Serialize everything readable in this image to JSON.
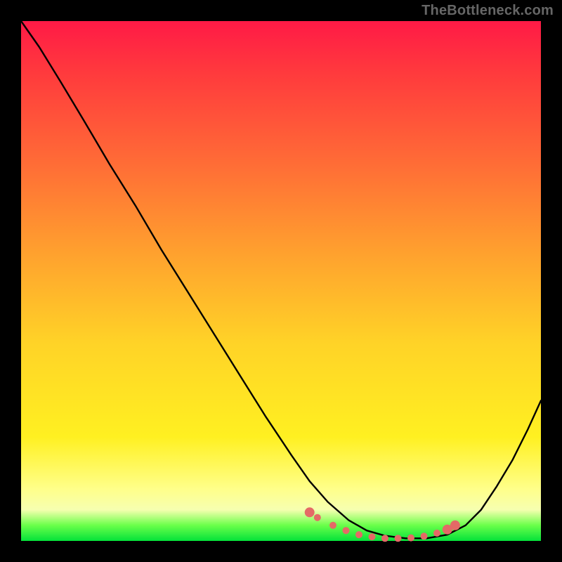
{
  "watermark": "TheBottleneck.com",
  "colors": {
    "frame": "#000000",
    "watermark_text": "#666666",
    "gradient_stops": [
      "#ff1a46",
      "#ff3a3d",
      "#ff6e36",
      "#ffa22e",
      "#ffd327",
      "#fff021",
      "#ffff8a",
      "#f6ffb0",
      "#6aff4a",
      "#04e23a"
    ],
    "curve": "#000000",
    "marker": "#e46a66"
  },
  "chart_data": {
    "type": "line",
    "title": "",
    "xlabel": "",
    "ylabel": "",
    "xlim": [
      0,
      1
    ],
    "ylim": [
      0,
      1
    ],
    "grid": false,
    "legend": false,
    "note": "No axis ticks or labels are present in the image; curve values are normalized [0,1] estimates read from pixel positions.",
    "series": [
      {
        "name": "curve",
        "x": [
          0.0,
          0.035,
          0.075,
          0.12,
          0.17,
          0.22,
          0.27,
          0.32,
          0.37,
          0.42,
          0.47,
          0.52,
          0.555,
          0.59,
          0.63,
          0.665,
          0.7,
          0.74,
          0.78,
          0.82,
          0.855,
          0.885,
          0.915,
          0.945,
          0.975,
          1.0
        ],
        "y": [
          1.0,
          0.95,
          0.885,
          0.81,
          0.725,
          0.645,
          0.56,
          0.48,
          0.4,
          0.32,
          0.24,
          0.165,
          0.115,
          0.075,
          0.04,
          0.02,
          0.01,
          0.005,
          0.005,
          0.012,
          0.03,
          0.06,
          0.105,
          0.155,
          0.215,
          0.27
        ]
      }
    ],
    "markers": {
      "name": "line-markers",
      "x": [
        0.555,
        0.57,
        0.6,
        0.625,
        0.65,
        0.675,
        0.7,
        0.725,
        0.75,
        0.775,
        0.8,
        0.82,
        0.835
      ],
      "y": [
        0.055,
        0.045,
        0.03,
        0.02,
        0.012,
        0.008,
        0.005,
        0.005,
        0.006,
        0.009,
        0.015,
        0.022,
        0.03
      ]
    }
  }
}
